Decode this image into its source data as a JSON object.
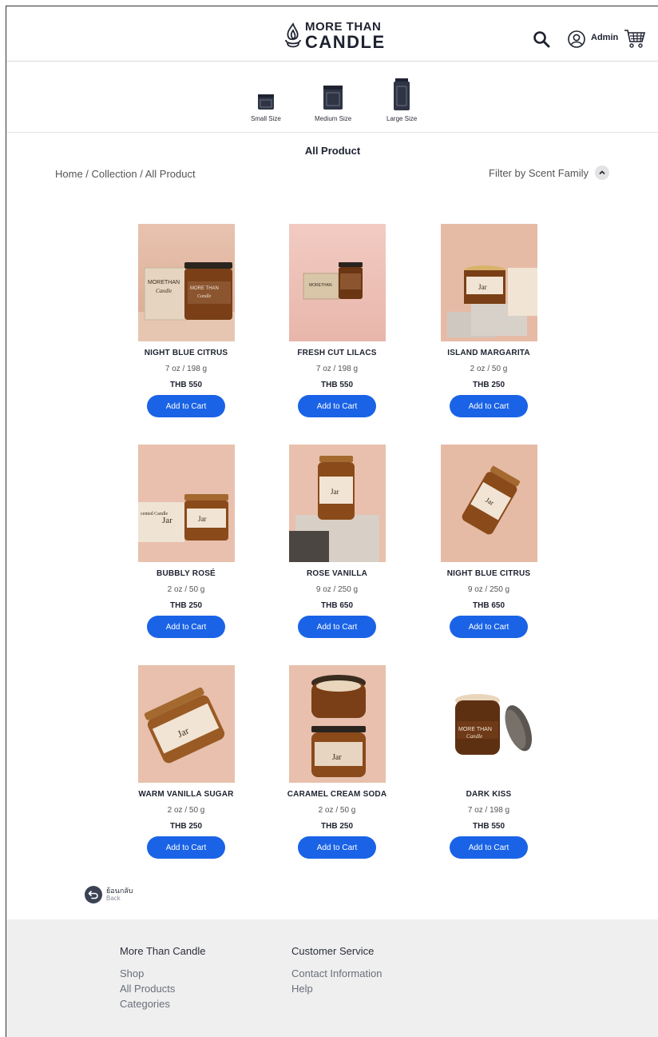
{
  "header": {
    "logo_top": "MORE THAN",
    "logo_bottom": "CANDLE",
    "user_label": "Admin"
  },
  "sizes": [
    {
      "label": "Small Size"
    },
    {
      "label": "Medium Size"
    },
    {
      "label": "Large Size"
    }
  ],
  "page_title": "All Product",
  "breadcrumb": [
    "Home",
    "Collection",
    "All Product"
  ],
  "breadcrumb_sep": " / ",
  "filter_label": "Filter by Scent Family",
  "products": [
    {
      "name": "NIGHT BLUE CITRUS",
      "weight": "7 oz / 198 g",
      "price": "THB 550",
      "button": "Add to Cart"
    },
    {
      "name": "FRESH CUT LILACS",
      "weight": "7 oz / 198 g",
      "price": "THB 550",
      "button": "Add to Cart"
    },
    {
      "name": "ISLAND MARGARITA",
      "weight": "2 oz / 50 g",
      "price": "THB 250",
      "button": "Add to Cart"
    },
    {
      "name": "BUBBLY ROSÉ",
      "weight": "2 oz / 50 g",
      "price": "THB 250",
      "button": "Add to Cart"
    },
    {
      "name": "ROSE VANILLA",
      "weight": "9 oz / 250 g",
      "price": "THB 650",
      "button": "Add to Cart"
    },
    {
      "name": "NIGHT BLUE CITRUS",
      "weight": "9 oz / 250 g",
      "price": "THB 650",
      "button": "Add to Cart"
    },
    {
      "name": "WARM VANILLA SUGAR",
      "weight": "2 oz / 50 g",
      "price": "THB 250",
      "button": "Add to Cart"
    },
    {
      "name": "CARAMEL CREAM SODA",
      "weight": "2 oz / 50 g",
      "price": "THB 250",
      "button": "Add to Cart"
    },
    {
      "name": "DARK KISS",
      "weight": "7 oz / 198 g",
      "price": "THB 550",
      "button": "Add to Cart"
    }
  ],
  "back": {
    "label_th": "ย้อนกลับ",
    "label_en": "Back"
  },
  "footer": {
    "col1": {
      "title": "More Than Candle",
      "links": [
        "Shop",
        "All Products",
        "Categories"
      ]
    },
    "col2": {
      "title": "Customer Service",
      "links": [
        "Contact Information",
        "Help"
      ]
    }
  },
  "colors": {
    "accent": "#1a63e6",
    "text": "#1e2230",
    "footer_bg": "#efefef"
  },
  "icons": [
    "flame-logo-icon",
    "search-icon",
    "user-icon",
    "cart-icon",
    "chevron-up-icon",
    "back-arrow-icon"
  ]
}
